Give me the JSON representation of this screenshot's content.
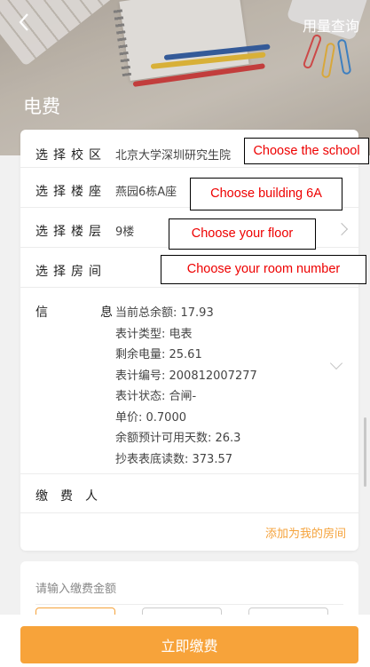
{
  "header": {
    "title": "电费",
    "usage_link": "用量查询"
  },
  "form": {
    "campus": {
      "label": "选择校区",
      "value": "北京大学深圳研究生院"
    },
    "building": {
      "label": "选择楼座",
      "value": "燕园6栋A座"
    },
    "floor": {
      "label": "选择楼层",
      "value": "9楼"
    },
    "room": {
      "label": "选择房间",
      "value": ""
    },
    "info": {
      "label": "信息",
      "lines": [
        "当前总余额: 17.93",
        "表计类型: 电表",
        "剩余电量: 25.61",
        "表计编号: 200812007277",
        "表计状态: 合闸-",
        "单价: 0.7000",
        "余额预计可用天数: 26.3",
        "抄表表底读数: 373.57"
      ]
    },
    "payer": {
      "label": "缴费人"
    },
    "add_room_link": "添加为我的房间"
  },
  "annotations": {
    "school": "Choose the school",
    "building": "Choose building 6A",
    "floor": "Choose your floor",
    "room": "Choose your room number"
  },
  "amount": {
    "placeholder": "请输入缴费金额"
  },
  "pay_button": "立即缴费",
  "colors": {
    "accent": "#f7a33a",
    "annotation_text": "#e00000"
  },
  "icons": {
    "back": "chevron-left-icon",
    "row_arrow": "chevron-right-icon",
    "expand": "chevron-down-icon"
  }
}
